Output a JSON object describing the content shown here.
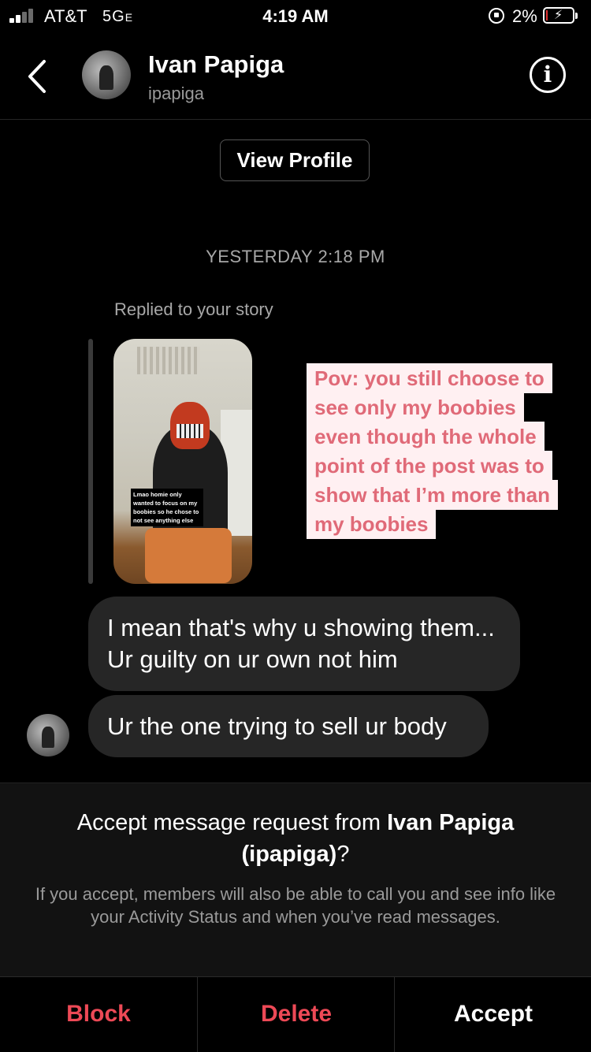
{
  "status_bar": {
    "carrier": "AT&T",
    "network": "5G",
    "network_suffix": "E",
    "time": "4:19 AM",
    "battery_percent": "2%"
  },
  "header": {
    "name": "Ivan Papiga",
    "username": "ipapiga"
  },
  "view_profile_label": "View Profile",
  "timestamp": "YESTERDAY 2:18 PM",
  "replied_label": "Replied to your story",
  "story": {
    "caption": "Lmao homie only wanted to focus on my boobies so he chose to not see anything else",
    "text": "Pov: you still choose to see only my boobies even though the whole point of the post was to show that I’m more than my boobies"
  },
  "messages": [
    "I mean that's why u showing them... Ur guilty on ur own not him",
    "Ur the one trying to sell ur body"
  ],
  "request": {
    "title_prefix": "Accept message request from ",
    "title_name": "Ivan Papiga (ipapiga)",
    "title_suffix": "?",
    "description": "If you accept, members will also be able to call you and see info like your Activity Status and when you’ve read messages."
  },
  "actions": {
    "block": "Block",
    "delete": "Delete",
    "accept": "Accept"
  },
  "colors": {
    "danger": "#ed4956",
    "bubble": "#262626",
    "story_text": "#e06a78",
    "story_text_bg": "#fff0f2"
  }
}
